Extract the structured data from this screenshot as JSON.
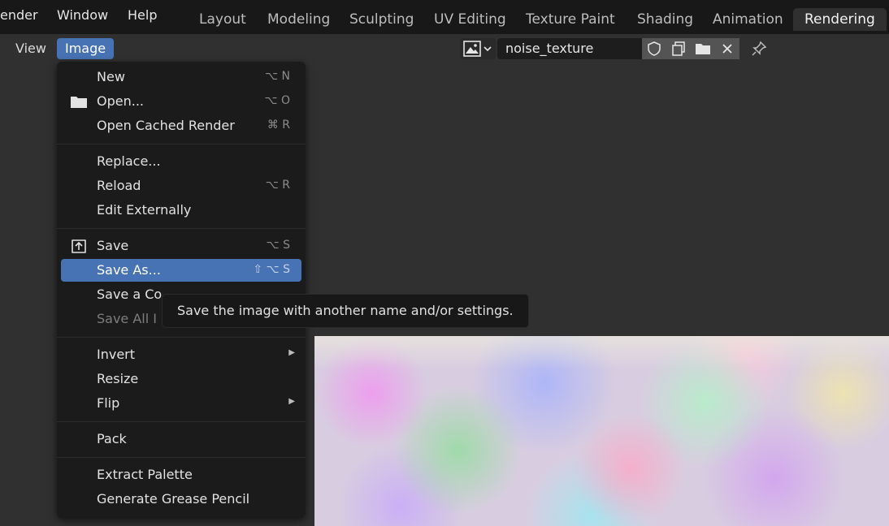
{
  "topbar": {
    "menus": [
      "ender",
      "Window",
      "Help"
    ],
    "workspaces": [
      "Layout",
      "Modeling",
      "Sculpting",
      "UV Editing",
      "Texture Paint",
      "Shading",
      "Animation",
      "Rendering"
    ],
    "active_workspace": "Rendering"
  },
  "header": {
    "view_label": "View",
    "image_label": "Image",
    "image_name": "noise_texture"
  },
  "menu": {
    "items": [
      {
        "label": "New",
        "shortcut": "⌥ N"
      },
      {
        "label": "Open...",
        "shortcut": "⌥ O",
        "icon": "folder-icon"
      },
      {
        "label": "Open Cached Render",
        "shortcut": "⌘ R"
      },
      {
        "label": "Replace...",
        "shortcut": ""
      },
      {
        "label": "Reload",
        "shortcut": "⌥ R"
      },
      {
        "label": "Edit Externally",
        "shortcut": ""
      },
      {
        "label": "Save",
        "shortcut": "⌥ S",
        "icon": "save-icon"
      },
      {
        "label": "Save As...",
        "shortcut": "⇧ ⌥ S",
        "highlighted": true
      },
      {
        "label": "Save a Co",
        "shortcut": ""
      },
      {
        "label": "Save All I",
        "shortcut": "",
        "disabled": true
      },
      {
        "label": "Invert",
        "shortcut": "",
        "submenu": true
      },
      {
        "label": "Resize",
        "shortcut": ""
      },
      {
        "label": "Flip",
        "shortcut": "",
        "submenu": true
      },
      {
        "label": "Pack",
        "shortcut": ""
      },
      {
        "label": "Extract Palette",
        "shortcut": ""
      },
      {
        "label": "Generate Grease Pencil",
        "shortcut": ""
      }
    ]
  },
  "tooltip": {
    "text": "Save the image with another name and/or settings."
  },
  "colors": {
    "accent": "#4772b3",
    "topbar_bg": "#181818",
    "menu_bg": "#1b1b1b",
    "editor_bg": "#303030"
  }
}
